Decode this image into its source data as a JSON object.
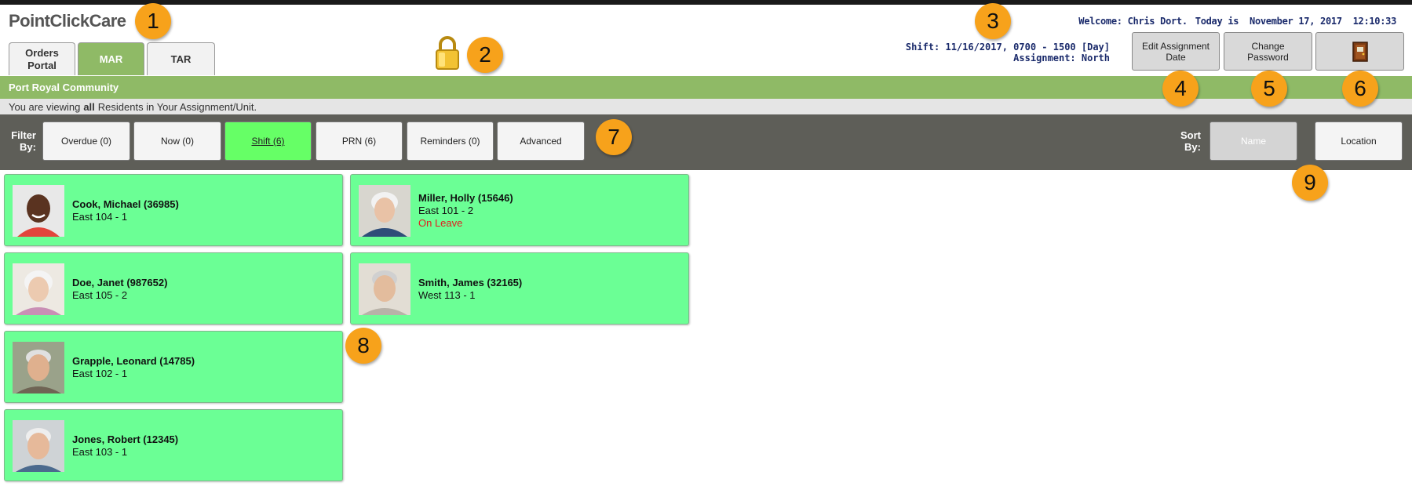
{
  "logo": "PointClickCare",
  "tabs": [
    {
      "label": "Orders Portal"
    },
    {
      "label": "MAR"
    },
    {
      "label": "TAR"
    }
  ],
  "header": {
    "welcome": "Welcome: Chris Dort.",
    "today": "Today is  November 17, 2017  12:10:33",
    "shift": "Shift: 11/16/2017, 0700 - 1500 [Day]",
    "assignment": "Assignment: North"
  },
  "buttons": {
    "edit_assignment": "Edit Assignment Date",
    "change_password": "Change Password"
  },
  "facility": "Port Royal Community",
  "viewing": {
    "prefix": "You are viewing",
    "bold": "all",
    "suffix": "Residents in Your Assignment/Unit."
  },
  "filter": {
    "label": "Filter By:",
    "options": [
      "Overdue (0)",
      "Now (0)",
      "Shift (6)",
      "PRN (6)",
      "Reminders (0)",
      "Advanced"
    ],
    "active": "Shift (6)"
  },
  "sort": {
    "label": "Sort By:",
    "options": [
      "Name",
      "Location"
    ],
    "active": "Name"
  },
  "residents": [
    {
      "name": "Cook, Michael (36985)",
      "room": "East 104 - 1",
      "status": ""
    },
    {
      "name": "Miller, Holly (15646)",
      "room": "East 101 - 2",
      "status": "On Leave"
    },
    {
      "name": "Doe, Janet (987652)",
      "room": "East 105 - 2",
      "status": ""
    },
    {
      "name": "Smith, James (32165)",
      "room": "West 113 - 1",
      "status": ""
    },
    {
      "name": "Grapple, Leonard (14785)",
      "room": "East 102 - 1",
      "status": ""
    },
    {
      "name": "Jones, Robert (12345)",
      "room": "East 103 - 1",
      "status": ""
    }
  ],
  "callouts": [
    "1",
    "2",
    "3",
    "4",
    "5",
    "6",
    "7",
    "8",
    "9"
  ],
  "colors": {
    "brand_green": "#8fba66",
    "card_green": "#6bff95",
    "active_filter": "#66ff66",
    "filter_bar": "#5e5e58",
    "callout": "#f7a21b",
    "header_text": "#1a2a6b",
    "on_leave": "#e02020"
  },
  "icons": {
    "lock": "lock-icon",
    "exit": "exit-door-icon"
  }
}
